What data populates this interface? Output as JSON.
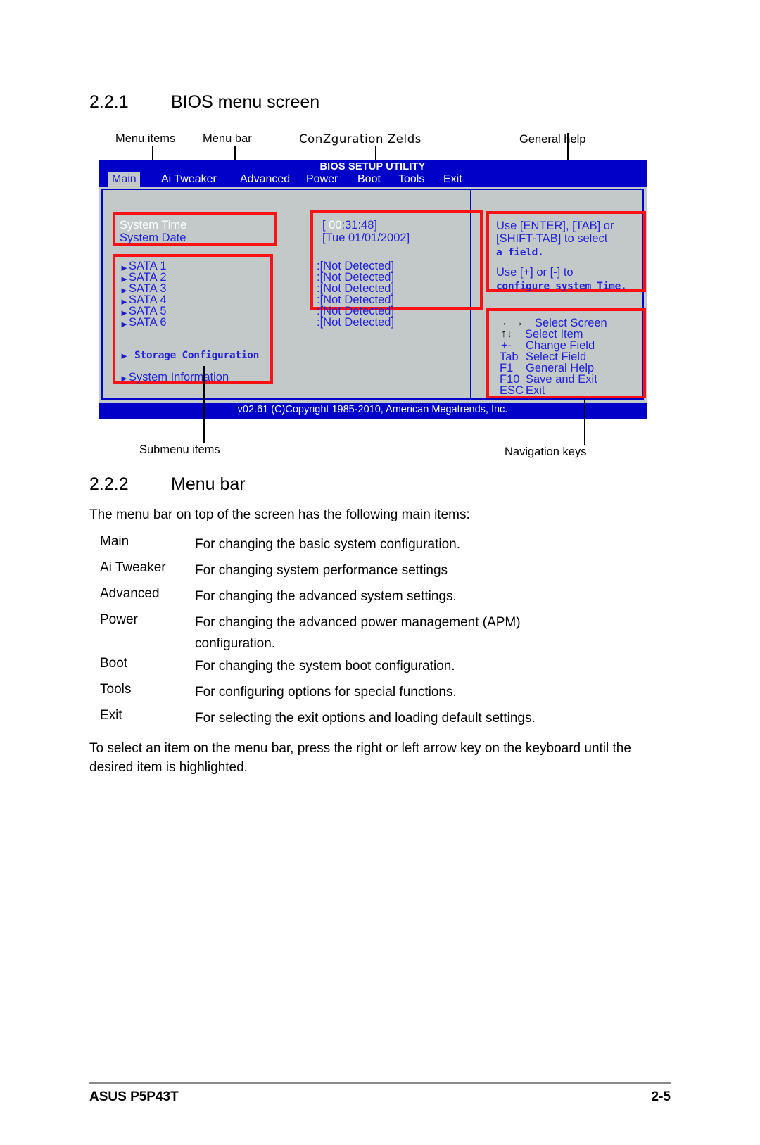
{
  "section1": {
    "number": "2.2.1",
    "title": "BIOS menu screen"
  },
  "callouts": {
    "menu_items": "Menu items",
    "menu_bar": "Menu bar",
    "configuration_fields": "ConZguration Zelds",
    "general_help": "General help",
    "submenu_items": "Submenu items",
    "navigation_keys": "Navigation keys"
  },
  "bios": {
    "title": "BIOS SETUP UTILITY",
    "tabs": [
      {
        "label": "Main",
        "active": true
      },
      {
        "label": "Ai Tweaker",
        "active": false
      },
      {
        "label": "Advanced",
        "active": false
      },
      {
        "label": "Power",
        "active": false
      },
      {
        "label": "Boot",
        "active": false
      },
      {
        "label": "Tools",
        "active": false
      },
      {
        "label": "Exit",
        "active": false
      }
    ],
    "menu_items": [
      {
        "label": "System Time",
        "value_prefix": "[ ",
        "value_hi": "00",
        "value_rest": ":31:48]",
        "selected": true
      },
      {
        "label": "System Date",
        "value": "[Tue 01/01/2002]",
        "selected": false
      }
    ],
    "sata_items": [
      {
        "label": "SATA 1",
        "value": ":[Not Detected]"
      },
      {
        "label": "SATA 2",
        "value": ":[Not Detected]"
      },
      {
        "label": "SATA 3",
        "value": ":[Not Detected]"
      },
      {
        "label": "SATA 4",
        "value": ":[Not Detected]"
      },
      {
        "label": "SATA 5",
        "value": ":[Not Detected]"
      },
      {
        "label": "SATA 6",
        "value": ":[Not Detected]"
      }
    ],
    "submenus": [
      {
        "label": "Storage Configuration",
        "mono": true
      },
      {
        "label": "System Information",
        "mono": false
      }
    ],
    "help": {
      "line1": "Use [ENTER], [TAB] or",
      "line2": "[SHIFT-TAB] to select",
      "line3": "a field.",
      "line4": "Use [+] or [-] to",
      "line5": "configure system Time."
    },
    "navkeys": [
      {
        "glyph": "←→",
        "key": "",
        "label": "Select Screen"
      },
      {
        "glyph": "↑↓",
        "key": "",
        "label": "Select Item"
      },
      {
        "glyph": "",
        "key": "+-",
        "label": "Change Field"
      },
      {
        "glyph": "",
        "key": "Tab",
        "label": "Select Field"
      },
      {
        "glyph": "",
        "key": "F1",
        "label": "General Help"
      },
      {
        "glyph": "",
        "key": "F10",
        "label": "Save and Exit"
      },
      {
        "glyph": "",
        "key": "ESC",
        "label": "Exit"
      }
    ],
    "copyright": "v02.61 (C)Copyright 1985-2010, American Megatrends, Inc."
  },
  "section2": {
    "number": "2.2.2",
    "title": "Menu bar",
    "intro": "The menu bar on top of the screen has the following main items:",
    "items": [
      {
        "term": "Main",
        "desc": "For changing the basic system configuration."
      },
      {
        "term": "Ai Tweaker",
        "desc": "For changing system performance settings"
      },
      {
        "term": "Advanced",
        "desc": "For changing the advanced system settings."
      },
      {
        "term": "Power",
        "desc": "For changing the advanced power management (APM) configuration."
      },
      {
        "term": "Boot",
        "desc": "For changing the system boot configuration."
      },
      {
        "term": "Tools",
        "desc": "For configuring options for special functions."
      },
      {
        "term": "Exit",
        "desc": "For selecting the exit options and loading default settings."
      }
    ],
    "outro": "To select an item on the menu bar, press the right or left arrow key on the keyboard until the desired item is highlighted."
  },
  "footer": {
    "left": "ASUS P5P43T",
    "right": "2-5"
  }
}
